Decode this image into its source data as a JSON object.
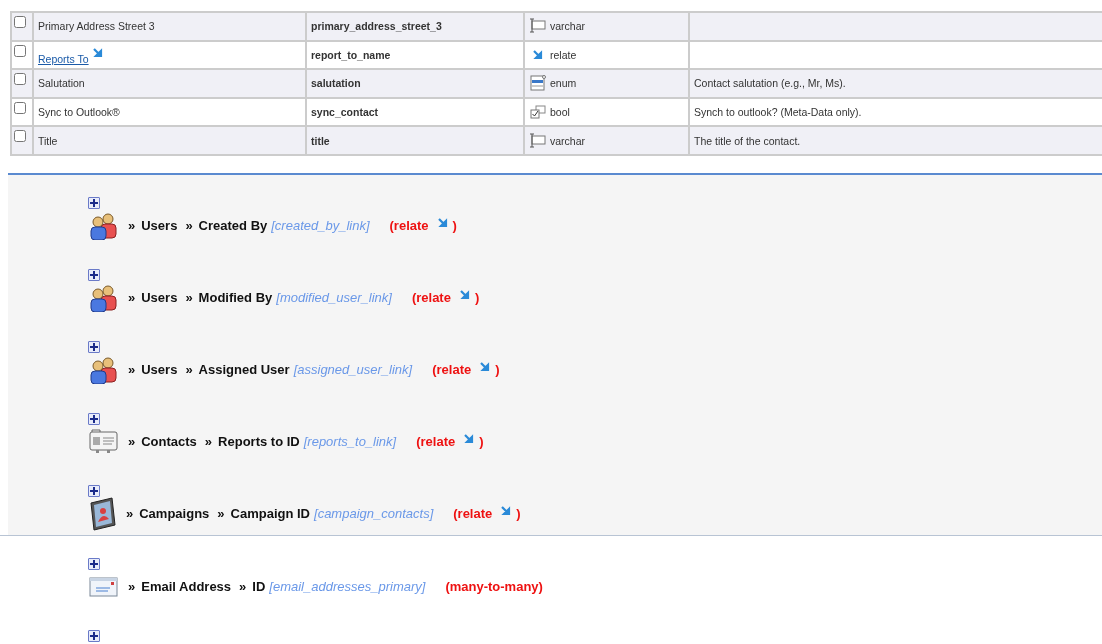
{
  "fields_table": {
    "rows": [
      {
        "checked": false,
        "label": {
          "kind": "plain",
          "text": "Primary Address Street 3"
        },
        "name": "primary_address_street_3",
        "type": {
          "kind": "text",
          "text": "varchar"
        },
        "description": ""
      },
      {
        "checked": false,
        "label": {
          "kind": "link",
          "text": "Reports To"
        },
        "name": "report_to_name",
        "type": {
          "kind": "relate",
          "text": "relate"
        },
        "description": ""
      },
      {
        "checked": false,
        "label": {
          "kind": "plain",
          "text": "Salutation"
        },
        "name": "salutation",
        "type": {
          "kind": "list",
          "text": "enum"
        },
        "description": "Contact salutation (e.g., Mr, Ms)."
      },
      {
        "checked": false,
        "label": {
          "kind": "plain",
          "text": "Sync to Outlook®"
        },
        "name": "sync_contact",
        "type": {
          "kind": "check",
          "text": "bool"
        },
        "description": "Synch to outlook? (Meta-Data only)."
      },
      {
        "checked": false,
        "label": {
          "kind": "plain",
          "text": "Title"
        },
        "name": "title",
        "type": {
          "kind": "text",
          "text": "varchar"
        },
        "description": "The title of the contact."
      }
    ]
  },
  "relationship_groups": [
    {
      "highlighted": true,
      "items": [
        {
          "expanded": false,
          "kind": "users",
          "separator_1": "»",
          "module": "Users",
          "separator_2": "»",
          "field": "Created By",
          "link": "[created_by_link]",
          "relation": "(relate",
          "relate_icon": true,
          "relation_close": ")"
        },
        {
          "expanded": false,
          "kind": "users",
          "separator_1": "»",
          "module": "Users",
          "separator_2": "»",
          "field": "Modified By",
          "link": "[modified_user_link]",
          "relation": "(relate",
          "relate_icon": true,
          "relation_close": ")"
        },
        {
          "expanded": false,
          "kind": "users",
          "separator_1": "»",
          "module": "Users",
          "separator_2": "»",
          "field": "Assigned User",
          "link": "[assigned_user_link]",
          "relation": "(relate",
          "relate_icon": true,
          "relation_close": ")"
        },
        {
          "expanded": false,
          "kind": "contacts",
          "separator_1": "»",
          "module": "Contacts",
          "separator_2": "»",
          "field": "Reports to ID",
          "link": "[reports_to_link]",
          "relation": "(relate",
          "relate_icon": true,
          "relation_close": ")"
        },
        {
          "expanded": false,
          "kind": "campaigns",
          "separator_1": "»",
          "module": "Campaigns",
          "separator_2": "»",
          "field": "Campaign ID",
          "link": "[campaign_contacts]",
          "relation": "(relate",
          "relate_icon": true,
          "relation_close": ")"
        }
      ]
    },
    {
      "highlighted": false,
      "items": [
        {
          "expanded": false,
          "kind": "email",
          "separator_1": "»",
          "module": "Email Address",
          "separator_2": "»",
          "field": "ID",
          "link": "[email_addresses_primary]",
          "relation": "(many-to-many)",
          "relate_icon": false
        },
        {
          "expanded": false
        }
      ]
    }
  ]
}
